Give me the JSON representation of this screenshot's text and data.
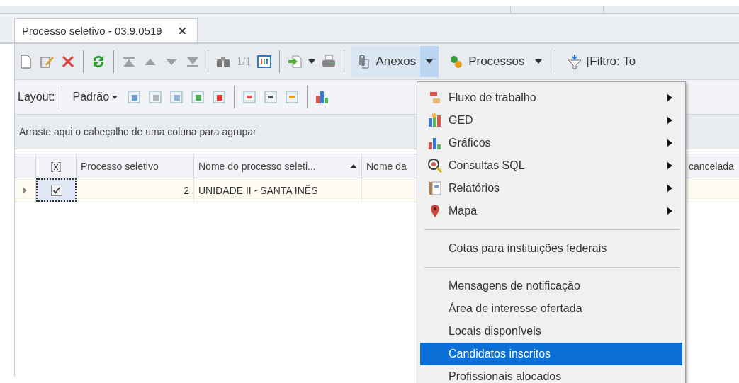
{
  "tabs": [
    {
      "label": "Processo seletivo - 03.9.0519",
      "close": "✕",
      "selected": true
    }
  ],
  "toolbar": {
    "page_counter": "1/1",
    "anexos": {
      "label": "Anexos",
      "pressed": true
    },
    "processos": {
      "label": "Processos",
      "pressed": false
    },
    "filter": "[Filtro: To"
  },
  "layout_bar": {
    "label": "Layout:",
    "preset": "Padrão"
  },
  "group_panel": {
    "hint": "Arraste aqui o cabeçalho de uma coluna para agrupar"
  },
  "grid": {
    "columns": [
      {
        "label": "[x]",
        "sorted": false
      },
      {
        "label": "Processo seletivo",
        "sorted": false
      },
      {
        "label": "Nome do processo seleti...",
        "sorted": true
      },
      {
        "label": "Nome da",
        "sorted": false
      },
      {
        "label": "cancelada",
        "sorted": false
      }
    ],
    "rows": [
      {
        "checked": true,
        "cells": [
          "",
          "2",
          "UNIDADE II - SANTA INÊS"
        ],
        "selected": true
      }
    ]
  },
  "menu": {
    "items": [
      {
        "kind": "item",
        "label": "Fluxo de trabalho",
        "submenu": true,
        "selected": false
      },
      {
        "kind": "item",
        "label": "GED",
        "submenu": true,
        "selected": false
      },
      {
        "kind": "item",
        "label": "Gráficos",
        "submenu": true,
        "selected": false
      },
      {
        "kind": "item",
        "label": "Consultas SQL",
        "submenu": true,
        "selected": false
      },
      {
        "kind": "item",
        "label": "Relatórios",
        "submenu": true,
        "selected": false
      },
      {
        "kind": "item",
        "label": "Mapa",
        "submenu": true,
        "selected": false
      },
      {
        "kind": "separator"
      },
      {
        "kind": "item",
        "label": "Cotas para instituições federais",
        "submenu": false,
        "selected": false
      },
      {
        "kind": "separator"
      },
      {
        "kind": "item",
        "label": "Mensagens de notificação",
        "submenu": false,
        "selected": false
      },
      {
        "kind": "item",
        "label": "Área de interesse ofertada",
        "submenu": false,
        "selected": false
      },
      {
        "kind": "item",
        "label": "Locais disponíveis",
        "submenu": false,
        "selected": false
      },
      {
        "kind": "item",
        "label": "Candidatos inscritos",
        "submenu": false,
        "selected": true
      },
      {
        "kind": "item",
        "label": "Profissionais alocados",
        "submenu": false,
        "selected": false
      }
    ]
  }
}
